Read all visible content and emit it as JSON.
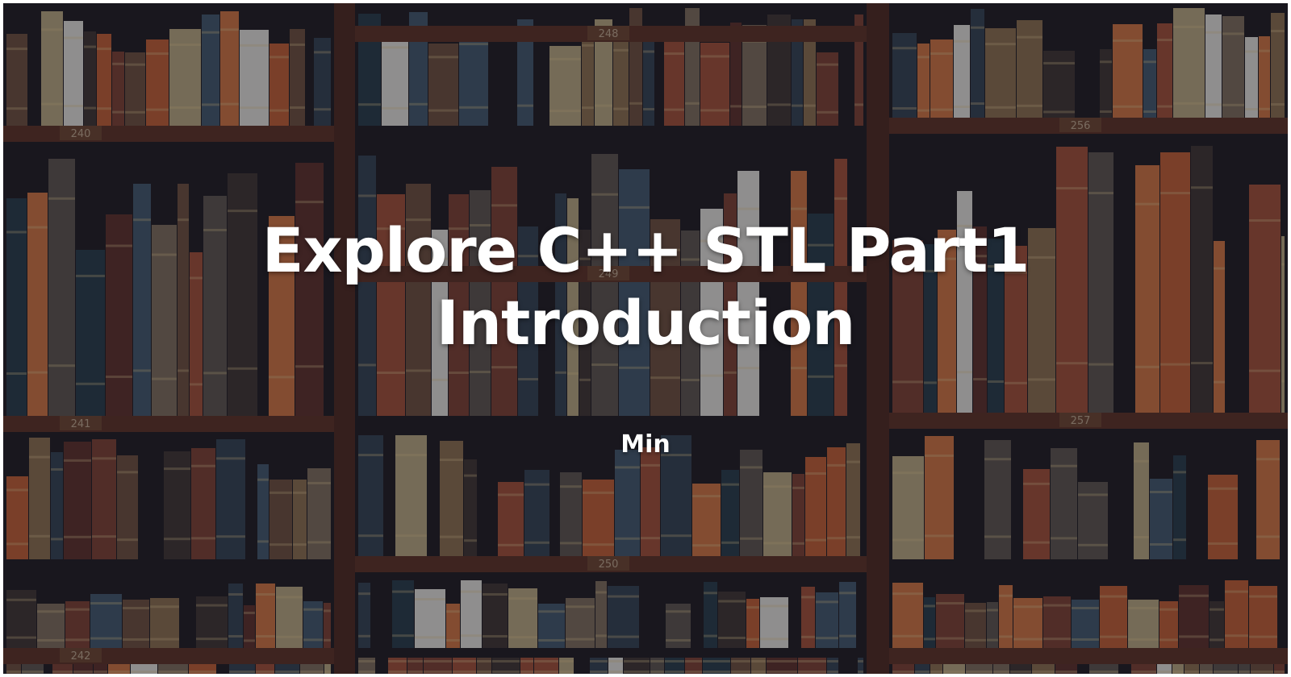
{
  "page": {
    "title_line1": "Explore C++ STL Part1",
    "title_line2": "Introduction",
    "author": "Min"
  },
  "background": {
    "description_icon": "bookshelf-image",
    "shelf_labels": [
      "240",
      "241",
      "242",
      "248",
      "249",
      "250",
      "256",
      "257"
    ]
  }
}
